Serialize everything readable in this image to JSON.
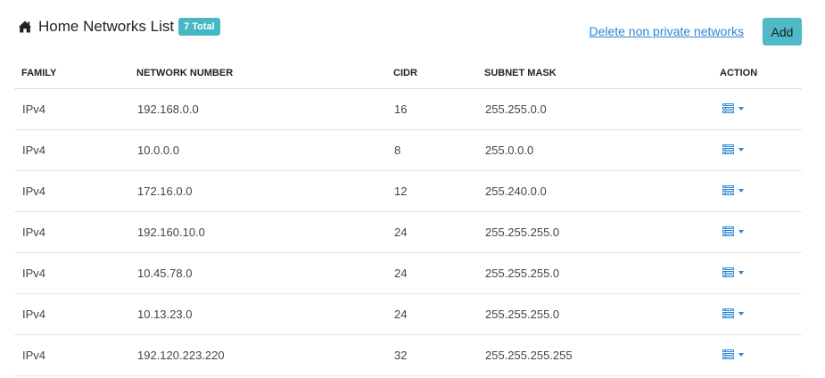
{
  "header": {
    "icon": "home-icon",
    "title": "Home Networks List",
    "badge": "7 Total"
  },
  "actions": {
    "delete_link": "Delete non private networks",
    "add_label": "Add"
  },
  "colors": {
    "badge": "#46b8c5",
    "add_button": "#4fbac7",
    "link": "#2a86d6"
  },
  "table": {
    "columns": [
      "FAMILY",
      "NETWORK NUMBER",
      "CIDR",
      "SUBNET MASK",
      "ACTION"
    ],
    "rows": [
      {
        "family": "IPv4",
        "network": "192.168.0.0",
        "cidr": "16",
        "mask": "255.255.0.0",
        "action_icon": "list-icon"
      },
      {
        "family": "IPv4",
        "network": "10.0.0.0",
        "cidr": "8",
        "mask": "255.0.0.0",
        "action_icon": "list-icon"
      },
      {
        "family": "IPv4",
        "network": "172.16.0.0",
        "cidr": "12",
        "mask": "255.240.0.0",
        "action_icon": "list-icon"
      },
      {
        "family": "IPv4",
        "network": "192.160.10.0",
        "cidr": "24",
        "mask": "255.255.255.0",
        "action_icon": "list-icon"
      },
      {
        "family": "IPv4",
        "network": "10.45.78.0",
        "cidr": "24",
        "mask": "255.255.255.0",
        "action_icon": "list-icon"
      },
      {
        "family": "IPv4",
        "network": "10.13.23.0",
        "cidr": "24",
        "mask": "255.255.255.0",
        "action_icon": "list-icon"
      },
      {
        "family": "IPv4",
        "network": "192.120.223.220",
        "cidr": "32",
        "mask": "255.255.255.255",
        "action_icon": "list-icon"
      }
    ]
  }
}
